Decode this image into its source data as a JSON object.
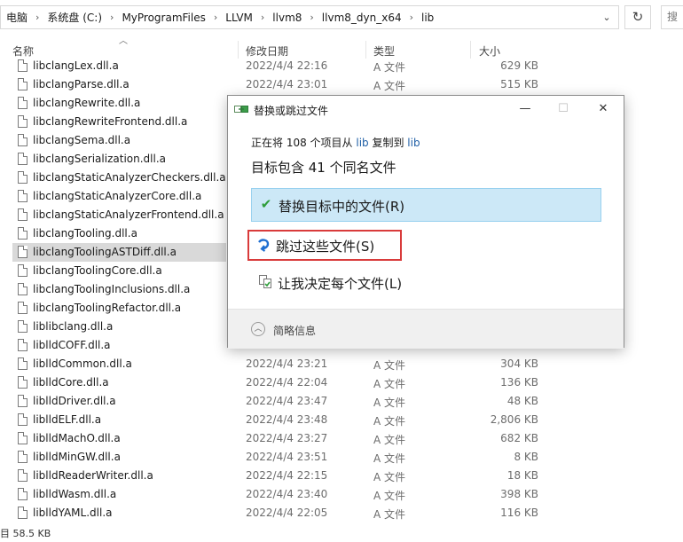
{
  "address_bar": {
    "crumbs": [
      "电脑",
      "系统盘 (C:)",
      "MyProgramFiles",
      "LLVM",
      "llvm8",
      "llvm8_dyn_x64",
      "lib"
    ]
  },
  "search_partial": "搜",
  "columns": {
    "name": "名称",
    "date": "修改日期",
    "type": "类型",
    "size": "大小"
  },
  "files": [
    {
      "name": "libclangLex.dll.a",
      "date": "2022/4/4 22:16",
      "type": "A 文件",
      "size": "629 KB"
    },
    {
      "name": "libclangParse.dll.a",
      "date": "2022/4/4 23:01",
      "type": "A 文件",
      "size": "515 KB"
    },
    {
      "name": "libclangRewrite.dll.a",
      "date": "",
      "type": "",
      "size": ""
    },
    {
      "name": "libclangRewriteFrontend.dll.a",
      "date": "",
      "type": "",
      "size": ""
    },
    {
      "name": "libclangSema.dll.a",
      "date": "",
      "type": "",
      "size": ""
    },
    {
      "name": "libclangSerialization.dll.a",
      "date": "",
      "type": "",
      "size": ""
    },
    {
      "name": "libclangStaticAnalyzerCheckers.dll.a",
      "date": "",
      "type": "",
      "size": ""
    },
    {
      "name": "libclangStaticAnalyzerCore.dll.a",
      "date": "",
      "type": "",
      "size": ""
    },
    {
      "name": "libclangStaticAnalyzerFrontend.dll.a",
      "date": "",
      "type": "",
      "size": ""
    },
    {
      "name": "libclangTooling.dll.a",
      "date": "",
      "type": "",
      "size": ""
    },
    {
      "name": "libclangToolingASTDiff.dll.a",
      "date": "",
      "type": "",
      "size": ""
    },
    {
      "name": "libclangToolingCore.dll.a",
      "date": "",
      "type": "",
      "size": ""
    },
    {
      "name": "libclangToolingInclusions.dll.a",
      "date": "",
      "type": "",
      "size": ""
    },
    {
      "name": "libclangToolingRefactor.dll.a",
      "date": "",
      "type": "",
      "size": ""
    },
    {
      "name": "liblibclang.dll.a",
      "date": "",
      "type": "",
      "size": ""
    },
    {
      "name": "liblldCOFF.dll.a",
      "date": "",
      "type": "",
      "size": ""
    },
    {
      "name": "liblldCommon.dll.a",
      "date": "2022/4/4 23:21",
      "type": "A 文件",
      "size": "304 KB"
    },
    {
      "name": "liblldCore.dll.a",
      "date": "2022/4/4 22:04",
      "type": "A 文件",
      "size": "136 KB"
    },
    {
      "name": "liblldDriver.dll.a",
      "date": "2022/4/4 23:47",
      "type": "A 文件",
      "size": "48 KB"
    },
    {
      "name": "liblldELF.dll.a",
      "date": "2022/4/4 23:48",
      "type": "A 文件",
      "size": "2,806 KB"
    },
    {
      "name": "liblldMachO.dll.a",
      "date": "2022/4/4 23:27",
      "type": "A 文件",
      "size": "682 KB"
    },
    {
      "name": "liblldMinGW.dll.a",
      "date": "2022/4/4 23:51",
      "type": "A 文件",
      "size": "8 KB"
    },
    {
      "name": "liblldReaderWriter.dll.a",
      "date": "2022/4/4 22:15",
      "type": "A 文件",
      "size": "18 KB"
    },
    {
      "name": "liblldWasm.dll.a",
      "date": "2022/4/4 23:40",
      "type": "A 文件",
      "size": "398 KB"
    },
    {
      "name": "liblldYAML.dll.a",
      "date": "2022/4/4 22:05",
      "type": "A 文件",
      "size": "116 KB"
    }
  ],
  "status_bar": {
    "text": "目  58.5 KB"
  },
  "dialog": {
    "title": "替换或跳过文件",
    "subtitle_prefix": "正在将 108 个项目从 ",
    "source": "lib",
    "subtitle_mid": " 复制到 ",
    "dest": "lib",
    "heading": "目标包含 41 个同名文件",
    "options": [
      {
        "label": "替换目标中的文件(R)",
        "icon": "check-icon"
      },
      {
        "label": "跳过这些文件(S)",
        "icon": "skip-arrow-icon"
      },
      {
        "label": "让我决定每个文件(L)",
        "icon": "compare-files-icon"
      }
    ],
    "more_info": "简略信息",
    "colors": {
      "replace_bg": "#cce8f7",
      "highlight_border": "#d93b3b",
      "check": "#2e9d3a",
      "skip": "#1f6fd1"
    }
  }
}
